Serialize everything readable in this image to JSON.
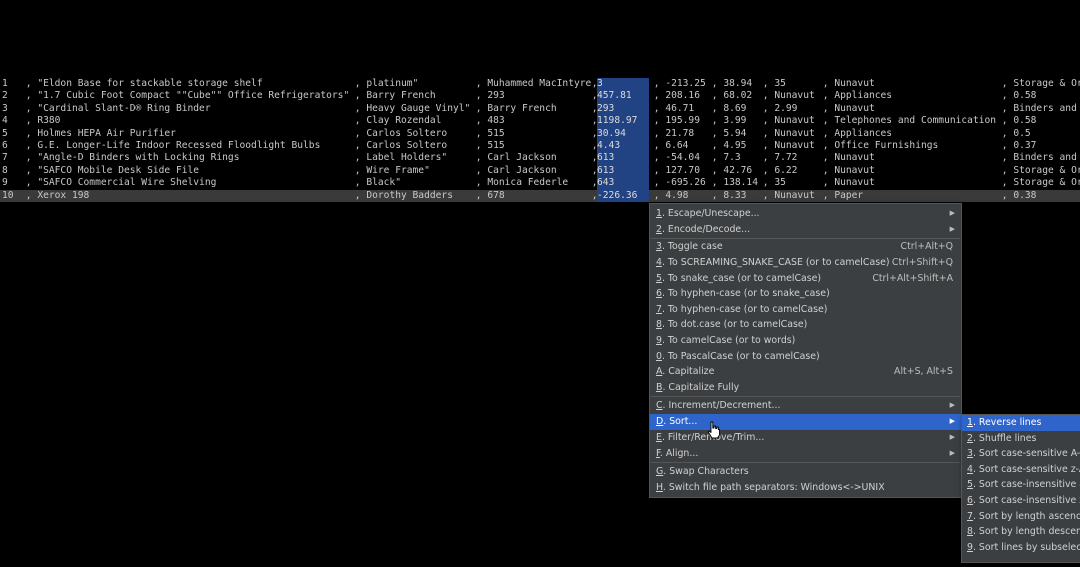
{
  "table": {
    "rows": [
      [
        "1",
        " , \"Eldon Base for stackable storage shelf",
        " , platinum\"",
        " , Muhammed MacIntyre",
        " , ",
        "3",
        " , -213.25",
        " , 38.94",
        " , 35",
        " , Nunavut",
        " , Storage & Org"
      ],
      [
        "2",
        " , \"1.7 Cubic Foot Compact \"\"Cube\"\" Office Refrigerators\"",
        " , Barry French",
        " , 293",
        " , ",
        "457.81",
        " , 208.16",
        " , 68.02",
        " , Nunavut",
        " , Appliances",
        " , 0.58"
      ],
      [
        "3",
        " , \"Cardinal Slant-D® Ring Binder",
        " , Heavy Gauge Vinyl\"",
        " , Barry French",
        " , ",
        "293",
        " , 46.71",
        " , 8.69",
        " , 2.99",
        " , Nunavut",
        " , Binders and B"
      ],
      [
        "4",
        " , R380",
        " , Clay Rozendal",
        " , 483",
        " , ",
        "1198.97",
        " , 195.99",
        " , 3.99",
        " , Nunavut",
        " , Telephones and Communication",
        " , 0.58"
      ],
      [
        "5",
        " , Holmes HEPA Air Purifier",
        " , Carlos Soltero",
        " , 515",
        " , ",
        "30.94",
        " , 21.78",
        " , 5.94",
        " , Nunavut",
        " , Appliances",
        " , 0.5"
      ],
      [
        "6",
        " , G.E. Longer-Life Indoor Recessed Floodlight Bulbs",
        " , Carlos Soltero",
        " , 515",
        " , ",
        "4.43",
        " , 6.64",
        " , 4.95",
        " , Nunavut",
        " , Office Furnishings",
        " , 0.37"
      ],
      [
        "7",
        " , \"Angle-D Binders with Locking Rings",
        " , Label Holders\"",
        " , Carl Jackson",
        " , ",
        "613",
        " , -54.04",
        " , 7.3",
        " , 7.72",
        " , Nunavut",
        " , Binders and B"
      ],
      [
        "8",
        " , \"SAFCO Mobile Desk Side File",
        " , Wire Frame\"",
        " , Carl Jackson",
        " , ",
        "613",
        " , 127.70",
        " , 42.76",
        " , 6.22",
        " , Nunavut",
        " , Storage & Org"
      ],
      [
        "9",
        " , \"SAFCO Commercial Wire Shelving",
        " , Black\"",
        " , Monica Federle",
        " , ",
        "643",
        " , -695.26",
        " , 138.14",
        " , 35",
        " , Nunavut",
        " , Storage & Org"
      ],
      [
        "10",
        " , Xerox 198",
        " , Dorothy Badders",
        " , 678",
        " , ",
        "-226.36",
        " , 4.98",
        " , 8.33",
        " , Nunavut",
        " , Paper",
        " , 0.38"
      ]
    ]
  },
  "main_menu": {
    "items": [
      {
        "mn": "1",
        "rest": ". Escape/Unescape...",
        "shortcut": "",
        "arrow": "▶"
      },
      {
        "mn": "2",
        "rest": ". Encode/Decode...",
        "shortcut": "",
        "arrow": "▶"
      },
      {
        "mn": "3",
        "rest": ". Toggle case",
        "shortcut": "Ctrl+Alt+Q",
        "arrow": ""
      },
      {
        "mn": "4",
        "rest": ". To SCREAMING_SNAKE_CASE (or to camelCase)",
        "shortcut": "Ctrl+Shift+Q",
        "arrow": ""
      },
      {
        "mn": "5",
        "rest": ". To snake_case (or to camelCase)",
        "shortcut": "Ctrl+Alt+Shift+A",
        "arrow": ""
      },
      {
        "mn": "6",
        "rest": ". To hyphen-case (or to snake_case)",
        "shortcut": "",
        "arrow": ""
      },
      {
        "mn": "7",
        "rest": ". To hyphen-case (or to camelCase)",
        "shortcut": "",
        "arrow": ""
      },
      {
        "mn": "8",
        "rest": ". To dot.case (or to camelCase)",
        "shortcut": "",
        "arrow": ""
      },
      {
        "mn": "9",
        "rest": ". To camelCase (or to words)",
        "shortcut": "",
        "arrow": ""
      },
      {
        "mn": "0",
        "rest": ". To PascalCase (or to camelCase)",
        "shortcut": "",
        "arrow": ""
      },
      {
        "mn": "A",
        "rest": ". Capitalize",
        "shortcut": "Alt+S, Alt+S",
        "arrow": ""
      },
      {
        "mn": "B",
        "rest": ". Capitalize Fully",
        "shortcut": "",
        "arrow": ""
      },
      {
        "mn": "C",
        "rest": ". Increment/Decrement...",
        "shortcut": "",
        "arrow": "▶"
      },
      {
        "mn": "D",
        "rest": ". Sort...",
        "shortcut": "",
        "arrow": "▶"
      },
      {
        "mn": "E",
        "rest": ". Filter/Remove/Trim...",
        "shortcut": "",
        "arrow": "▶"
      },
      {
        "mn": "F",
        "rest": ". Align...",
        "shortcut": "",
        "arrow": "▶"
      },
      {
        "mn": "G",
        "rest": ". Swap Characters",
        "shortcut": "",
        "arrow": ""
      },
      {
        "mn": "H",
        "rest": ". Switch file path separators: Windows<->UNIX",
        "shortcut": "",
        "arrow": ""
      }
    ]
  },
  "sort_menu": {
    "items": [
      {
        "mn": "1",
        "rest": ". Reverse lines"
      },
      {
        "mn": "2",
        "rest": ". Shuffle lines"
      },
      {
        "mn": "3",
        "rest": ". Sort case-sensitive A-z"
      },
      {
        "mn": "4",
        "rest": ". Sort case-sensitive z-A"
      },
      {
        "mn": "5",
        "rest": ". Sort case-insensitive a-z"
      },
      {
        "mn": "6",
        "rest": ". Sort case-insensitive z-a"
      },
      {
        "mn": "7",
        "rest": ". Sort by length ascending"
      },
      {
        "mn": "8",
        "rest": ". Sort by length descending"
      },
      {
        "mn": "9",
        "rest": ". Sort lines by subselection"
      }
    ]
  },
  "colors": {
    "selection": "#214283",
    "menu_highlight": "#2f65ca",
    "menu_bg": "#3c3f41"
  },
  "icons": {
    "submenu_arrow": "triangle-right-icon",
    "pointer": "hand-pointer-icon"
  }
}
